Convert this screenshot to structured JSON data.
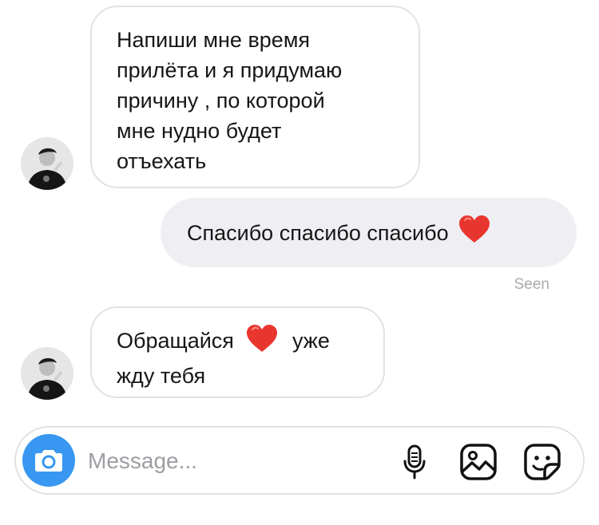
{
  "messages": [
    {
      "direction": "incoming",
      "lines": [
        "Напиши мне время",
        "прилёта и я придумаю",
        "причину , по которой",
        "мне нудно будет",
        "отъехать"
      ]
    },
    {
      "direction": "outgoing",
      "text": "Спасибо спасибо спасибо",
      "emoji": "heart"
    },
    {
      "direction": "incoming",
      "line1_before": "Обращайся",
      "line1_emoji": "heart",
      "line1_after": "уже",
      "line2": "жду тебя"
    }
  ],
  "seen_label": "Seen",
  "composer": {
    "placeholder": "Message...",
    "icons": [
      "camera-icon",
      "microphone-icon",
      "gallery-icon",
      "sticker-icon"
    ]
  },
  "colors": {
    "accent": "#3897f0",
    "outgoing_bubble": "#efeff3",
    "incoming_border": "#e2e2e6",
    "heart": "#e8362f"
  }
}
